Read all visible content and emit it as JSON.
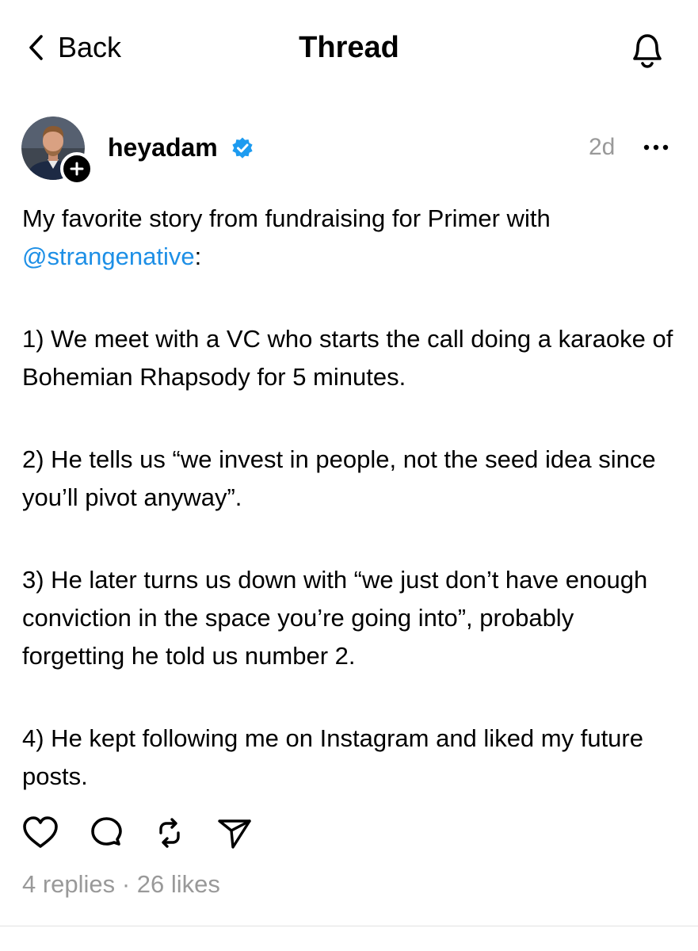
{
  "header": {
    "back_label": "Back",
    "title": "Thread"
  },
  "post": {
    "username": "heyadam",
    "verified": true,
    "timestamp": "2d",
    "intro_before_mention": "My favorite story from fundraising for Primer with",
    "mention": "@strangenative",
    "intro_after_mention": ":",
    "point_1": "1) We meet with a VC who starts the call doing a karaoke of Bohemian Rhapsody for 5 minutes.",
    "point_2": "2) He tells us “we invest in people, not the seed idea since you’ll pivot anyway”.",
    "point_3": "3) He later turns us down with “we just don’t have enough conviction in the space you’re going into”, probably forgetting he told us number 2.",
    "point_4": "4) He kept following me on Instagram and liked my future posts."
  },
  "stats": {
    "replies": "4 replies",
    "separator": "·",
    "likes": "26 likes"
  },
  "icons": {
    "back": "chevron-left-icon",
    "notifications": "bell-icon",
    "verified": "verified-badge-icon",
    "follow": "plus-icon",
    "more": "more-horizontal-icon",
    "like": "heart-icon",
    "reply": "comment-icon",
    "repost": "repost-icon",
    "share": "send-icon"
  },
  "colors": {
    "mention": "#1d8fe6",
    "verified": "#1d9bf0",
    "muted": "#999999"
  }
}
